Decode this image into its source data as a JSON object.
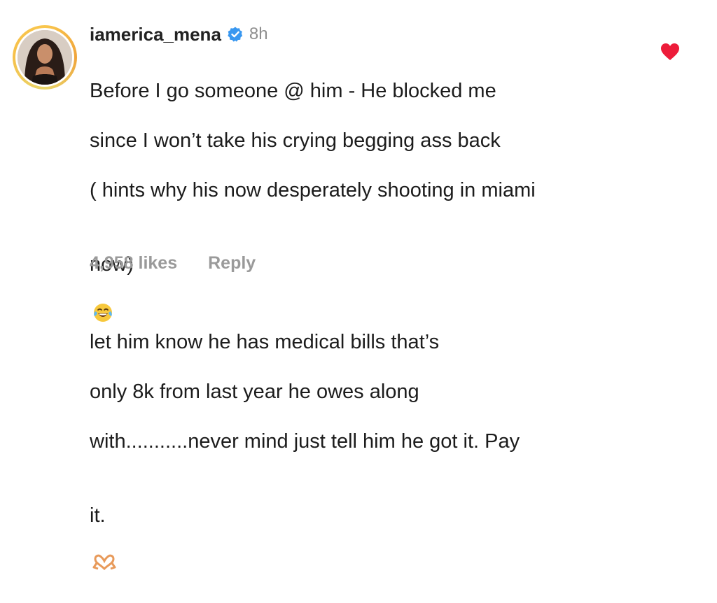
{
  "comment": {
    "username": "iamerica_mena",
    "time": "8h",
    "text_lines": [
      "Before I go someone @ him - He blocked me",
      "since I won’t take his crying begging ass back",
      "( hints why his now desperately shooting in miami",
      "now)",
      "let him know he has medical bills that’s",
      "only 8k from last year he owes along",
      "with...........never mind just tell him he got it. Pay",
      "it."
    ],
    "likes": "4,958 likes",
    "reply_label": "Reply",
    "verified_icon": "verified-badge-icon",
    "laugh_emoji": "face-with-tears-of-joy-icon",
    "heart_hands_emoji": "heart-hands-icon",
    "like_icon": "heart-icon",
    "colors": {
      "username": "#222222",
      "meta": "#8e8e8e",
      "verified": "#3897f0",
      "heart": "#ed1c3a",
      "avatar_ring": "#f4b740"
    }
  }
}
